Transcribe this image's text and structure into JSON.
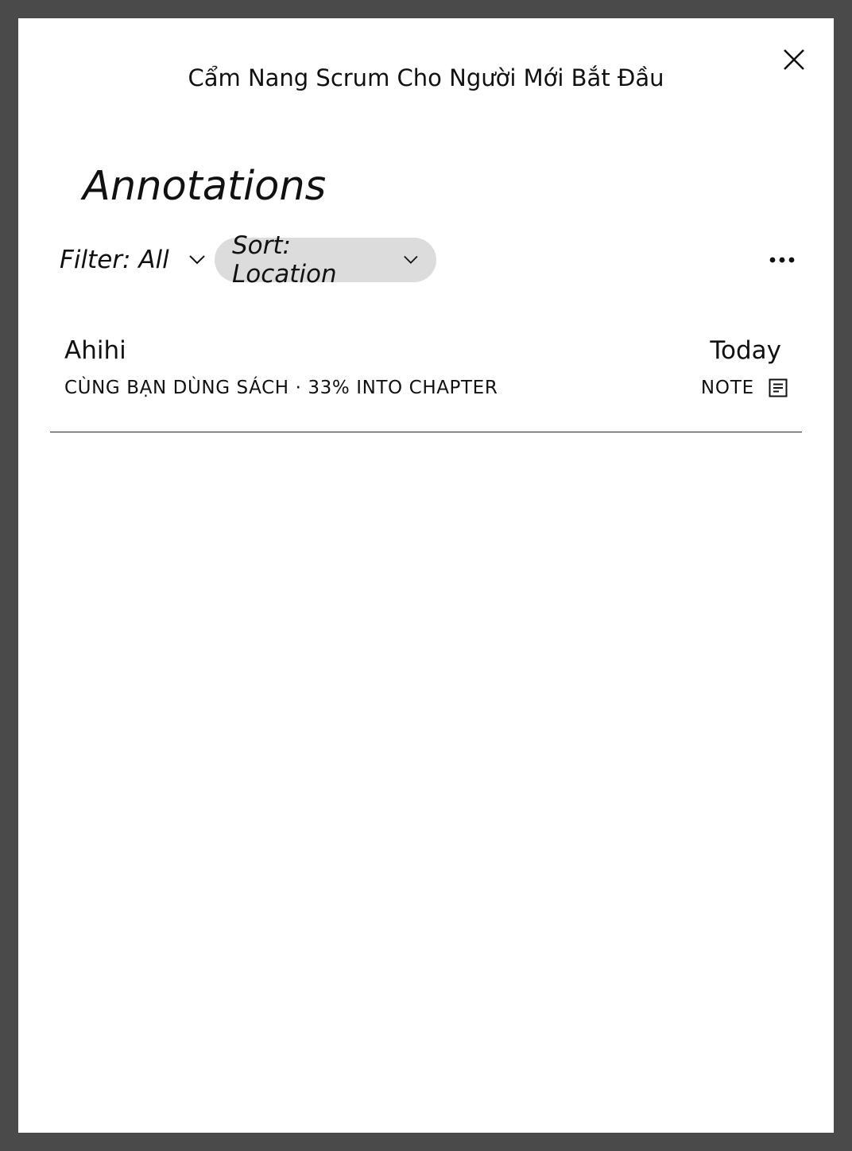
{
  "header": {
    "book_title": "Cẩm Nang Scrum Cho Người Mới Bắt Đầu",
    "close_icon": "close-icon"
  },
  "page": {
    "title": "Annotations"
  },
  "toolbar": {
    "filter_label": "Filter: All",
    "sort_label": "Sort: Location",
    "more_icon": "more-horizontal-icon"
  },
  "annotations": [
    {
      "text": "Ahihi",
      "date": "Today",
      "meta": "CÙNG BẠN DÙNG SÁCH · 33% INTO CHAPTER",
      "type": "NOTE",
      "type_icon": "note-icon"
    }
  ],
  "colors": {
    "frame": "#4a4a4a",
    "panel": "#ffffff",
    "sort_pill": "#dcdcdc",
    "text": "#111111"
  }
}
